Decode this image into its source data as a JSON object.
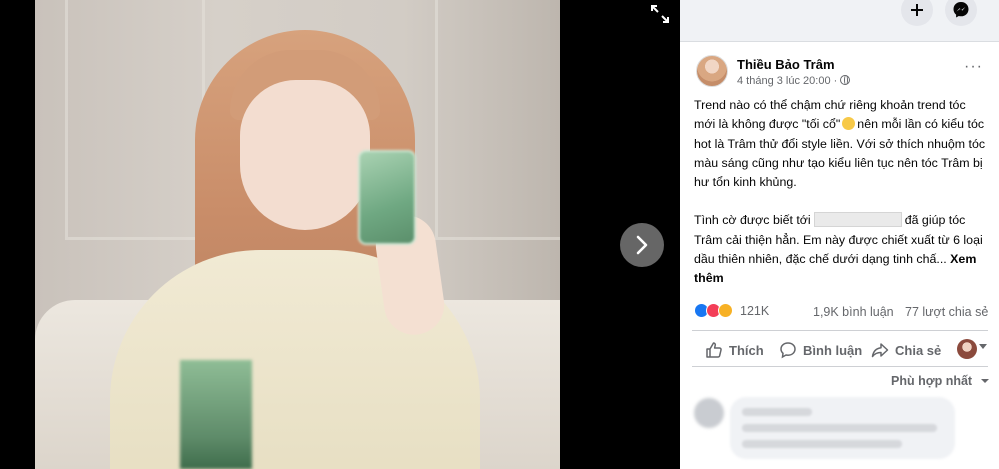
{
  "viewer": {
    "expand_icon": "expand-icon",
    "next_icon": "chevron-right-icon"
  },
  "topbar": {
    "create_icon": "plus-icon",
    "messenger_icon": "messenger-icon"
  },
  "post": {
    "author": "Thiều Bảo Trâm",
    "timestamp": "4 tháng 3 lúc 20:00 ·",
    "privacy_icon": "globe-icon",
    "more_icon": "more-horizontal-icon",
    "more_label": "···",
    "text_p1_a": "Trend nào có thể chậm chứ riêng khoản trend tóc mới là không được \"tối cổ\"",
    "text_p1_b": "nên mỗi lần có kiểu tóc hot là Trâm thử đổi style liền. Với sở thích nhuộm tóc màu sáng cũng như tạo kiểu liên tục nên tóc Trâm bị hư tổn kinh khủng.",
    "text_p2_a": "Tình cờ được biết tới",
    "text_p2_b": "đã giúp tóc Trâm cải thiện hẳn. Em này được chiết xuất từ 6 loại dầu thiên nhiên, đặc chế dưới dạng tinh chấ...",
    "see_more": "Xem thêm"
  },
  "stats": {
    "reaction_icons": [
      "like-reaction-icon",
      "love-reaction-icon",
      "care-reaction-icon"
    ],
    "reactions": "121K",
    "comments": "1,9K bình luận",
    "shares": "77 lượt chia sẻ"
  },
  "actions": {
    "like": "Thích",
    "comment": "Bình luận",
    "share": "Chia sẻ"
  },
  "comments": {
    "sort_label": "Phù hợp nhất"
  },
  "colors": {
    "panel_bg": "#ffffff",
    "topbar_bg": "#f0f2f5",
    "secondary_text": "#65676b",
    "primary_text": "#050505"
  }
}
